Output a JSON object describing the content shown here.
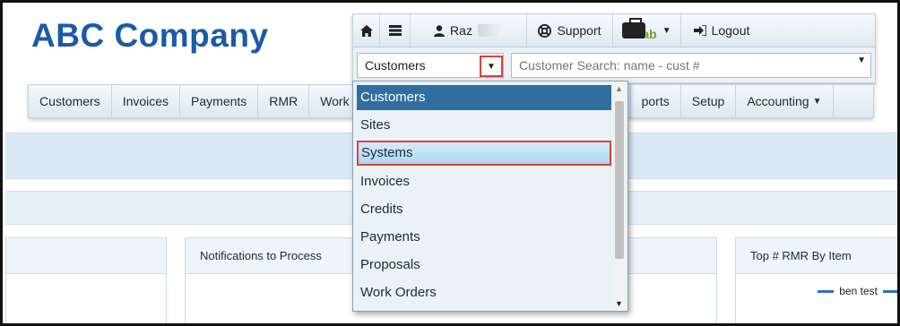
{
  "logo": "ABC Company",
  "topbar": {
    "home_icon": "home-icon",
    "list_icon": "list-icon",
    "user_icon": "user-icon",
    "user_name": "Raz",
    "support_icon": "lifebuoy-icon",
    "support_label": "Support",
    "case_icon": "briefcase-icon",
    "case_badge": "ab",
    "logout_icon": "logout-icon",
    "logout_label": "Logout"
  },
  "search": {
    "selected": "Customers",
    "placeholder": "Customer Search: name - cust #"
  },
  "nav": {
    "items": [
      "Customers",
      "Invoices",
      "Payments",
      "RMR",
      "Work",
      "ports",
      "Setup",
      "Accounting"
    ]
  },
  "dropdown": {
    "options": [
      "Customers",
      "Sites",
      "Systems",
      "Invoices",
      "Credits",
      "Payments",
      "Proposals",
      "Work Orders"
    ],
    "active_index": 0,
    "highlight_index": 2
  },
  "panels": {
    "notifications_title": "Notifications to Process",
    "rmr_title": "Top # RMR By Item",
    "rmr_legend": "ben test"
  },
  "colors": {
    "logo": "#1a5aa8",
    "highlight_border": "#d9413a",
    "active_option": "#2f6e9e"
  }
}
